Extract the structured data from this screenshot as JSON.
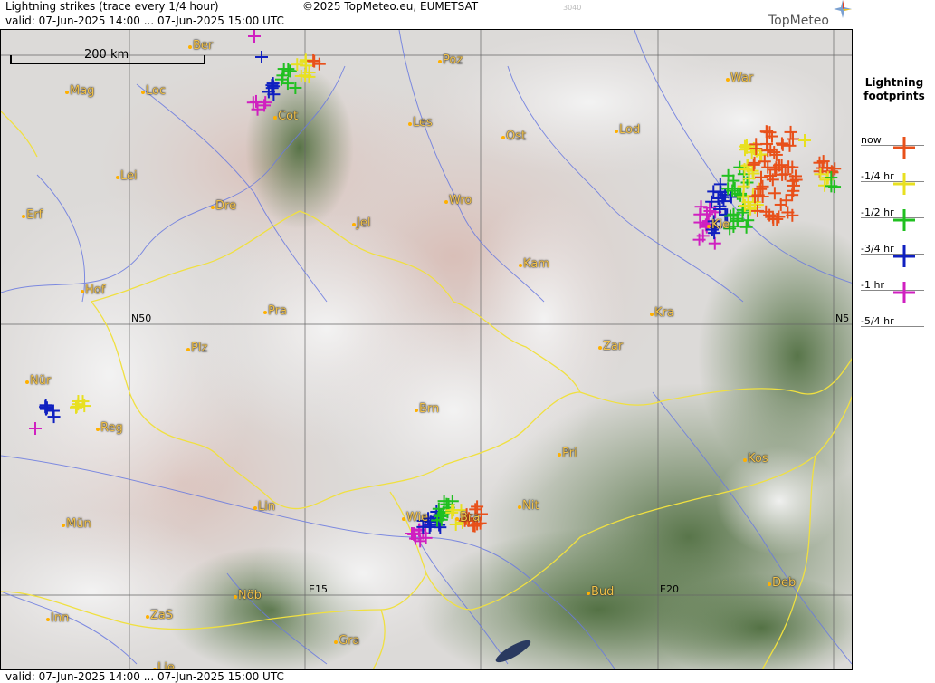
{
  "header": {
    "title": "Lightning strikes (trace every 1/4 hour)",
    "valid": "valid:  07-Jun-2025 14:00 ... 07-Jun-2025 15:00 UTC",
    "copyright": "©2025 TopMeteo.eu, EUMETSAT",
    "image_id": "3040",
    "logo_text": "TopMeteo"
  },
  "footer": {
    "valid": "valid:  07-Jun-2025 14:00 ... 07-Jun-2025 15:00 UTC"
  },
  "scale": {
    "label": "200 km"
  },
  "legend": {
    "title_line1": "Lightning",
    "title_line2": "footprints",
    "items": [
      {
        "label": "now",
        "color": "#e8501a"
      },
      {
        "label": "-1/4 hr",
        "color": "#e8e020"
      },
      {
        "label": "-1/2 hr",
        "color": "#20c020"
      },
      {
        "label": "-3/4 hr",
        "color": "#1020c0"
      },
      {
        "label": "-1 hr",
        "color": "#d020c0"
      },
      {
        "label": "-5/4 hr",
        "color": ""
      }
    ]
  },
  "coords": {
    "n50": "N50",
    "n50_right": "N5",
    "e15": "E15",
    "e20": "E20"
  },
  "cities": [
    {
      "name": "Ber"
    },
    {
      "name": "Poz"
    },
    {
      "name": "War"
    },
    {
      "name": "Mag"
    },
    {
      "name": "Loc"
    },
    {
      "name": "Cot"
    },
    {
      "name": "Les"
    },
    {
      "name": "Ost"
    },
    {
      "name": "Lod"
    },
    {
      "name": "Lei"
    },
    {
      "name": "Wro"
    },
    {
      "name": "Kie"
    },
    {
      "name": "Erf"
    },
    {
      "name": "Dre"
    },
    {
      "name": "Jel"
    },
    {
      "name": "Kam"
    },
    {
      "name": "Hof"
    },
    {
      "name": "Pra"
    },
    {
      "name": "Kra"
    },
    {
      "name": "Plz"
    },
    {
      "name": "Zar"
    },
    {
      "name": "Nür"
    },
    {
      "name": "Brn"
    },
    {
      "name": "Reg"
    },
    {
      "name": "Pri"
    },
    {
      "name": "Kos"
    },
    {
      "name": "Lin"
    },
    {
      "name": "Nit"
    },
    {
      "name": "Wie"
    },
    {
      "name": "Bra"
    },
    {
      "name": "Mün"
    },
    {
      "name": "Nöb"
    },
    {
      "name": "Bud"
    },
    {
      "name": "Deb"
    },
    {
      "name": "ZaS"
    },
    {
      "name": "Inn"
    },
    {
      "name": "Gra"
    },
    {
      "name": "Lje"
    }
  ],
  "colors": {
    "now": "#e8501a",
    "q1": "#e8e020",
    "q2": "#20c020",
    "q3": "#1020c0",
    "q4": "#d020c0",
    "border": "#f0e040",
    "river": "#6a7ae0",
    "grid": "#555555"
  }
}
